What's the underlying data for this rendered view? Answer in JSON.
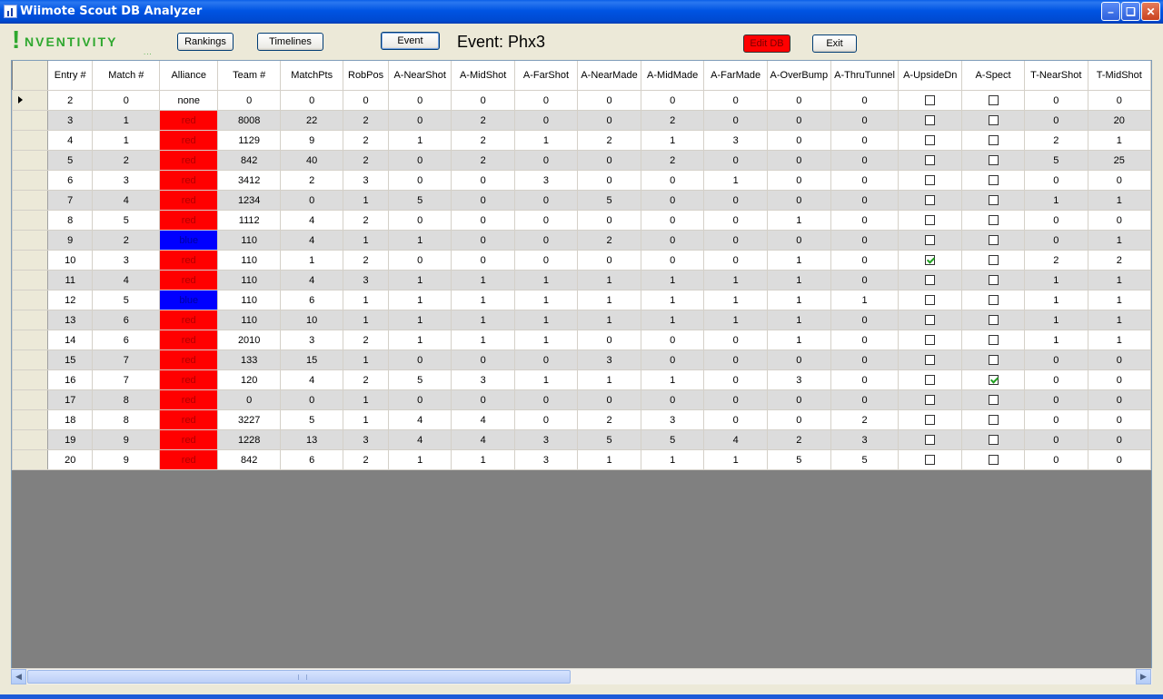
{
  "window": {
    "title": "Wiimote Scout DB Analyzer",
    "controls": [
      "minimize-icon",
      "restore-icon",
      "close-icon"
    ]
  },
  "logo": {
    "text": "NVENTIVITY",
    "bang": "!",
    "dots": "..."
  },
  "toolbar": {
    "rankings": "Rankings",
    "timelines": "Timelines",
    "event": "Event",
    "event_label": "Event:  Phx3",
    "edit_db": "Edit DB",
    "exit": "Exit"
  },
  "colors": {
    "red": "#ff0000",
    "blue": "#0000ff",
    "accent_green": "#2fa82f"
  },
  "grid": {
    "columns": [
      "Entry #",
      "Match #",
      "Alliance",
      "Team #",
      "MatchPts",
      "RobPos",
      "A-NearShot",
      "A-MidShot",
      "A-FarShot",
      "A-NearMade",
      "A-MidMade",
      "A-FarMade",
      "A-OverBump",
      "A-ThruTunnel",
      "A-UpsideDn",
      "A-Spect",
      "T-NearShot",
      "T-MidShot"
    ],
    "rows": [
      [
        "2",
        "0",
        "none",
        "0",
        "0",
        "0",
        "0",
        "0",
        "0",
        "0",
        "0",
        "0",
        "0",
        "0",
        false,
        false,
        "0",
        "0"
      ],
      [
        "3",
        "1",
        "red",
        "8008",
        "22",
        "2",
        "0",
        "2",
        "0",
        "0",
        "2",
        "0",
        "0",
        "0",
        false,
        false,
        "0",
        "20"
      ],
      [
        "4",
        "1",
        "red",
        "1129",
        "9",
        "2",
        "1",
        "2",
        "1",
        "2",
        "1",
        "3",
        "0",
        "0",
        false,
        false,
        "2",
        "1"
      ],
      [
        "5",
        "2",
        "red",
        "842",
        "40",
        "2",
        "0",
        "2",
        "0",
        "0",
        "2",
        "0",
        "0",
        "0",
        false,
        false,
        "5",
        "25"
      ],
      [
        "6",
        "3",
        "red",
        "3412",
        "2",
        "3",
        "0",
        "0",
        "3",
        "0",
        "0",
        "1",
        "0",
        "0",
        false,
        false,
        "0",
        "0"
      ],
      [
        "7",
        "4",
        "red",
        "1234",
        "0",
        "1",
        "5",
        "0",
        "0",
        "5",
        "0",
        "0",
        "0",
        "0",
        false,
        false,
        "1",
        "1"
      ],
      [
        "8",
        "5",
        "red",
        "1112",
        "4",
        "2",
        "0",
        "0",
        "0",
        "0",
        "0",
        "0",
        "1",
        "0",
        false,
        false,
        "0",
        "0"
      ],
      [
        "9",
        "2",
        "blue",
        "110",
        "4",
        "1",
        "1",
        "0",
        "0",
        "2",
        "0",
        "0",
        "0",
        "0",
        false,
        false,
        "0",
        "1"
      ],
      [
        "10",
        "3",
        "red",
        "110",
        "1",
        "2",
        "0",
        "0",
        "0",
        "0",
        "0",
        "0",
        "1",
        "0",
        true,
        false,
        "2",
        "2"
      ],
      [
        "11",
        "4",
        "red",
        "110",
        "4",
        "3",
        "1",
        "1",
        "1",
        "1",
        "1",
        "1",
        "1",
        "0",
        false,
        false,
        "1",
        "1"
      ],
      [
        "12",
        "5",
        "blue",
        "110",
        "6",
        "1",
        "1",
        "1",
        "1",
        "1",
        "1",
        "1",
        "1",
        "1",
        false,
        false,
        "1",
        "1"
      ],
      [
        "13",
        "6",
        "red",
        "110",
        "10",
        "1",
        "1",
        "1",
        "1",
        "1",
        "1",
        "1",
        "1",
        "0",
        false,
        false,
        "1",
        "1"
      ],
      [
        "14",
        "6",
        "red",
        "2010",
        "3",
        "2",
        "1",
        "1",
        "1",
        "0",
        "0",
        "0",
        "1",
        "0",
        false,
        false,
        "1",
        "1"
      ],
      [
        "15",
        "7",
        "red",
        "133",
        "15",
        "1",
        "0",
        "0",
        "0",
        "3",
        "0",
        "0",
        "0",
        "0",
        false,
        false,
        "0",
        "0"
      ],
      [
        "16",
        "7",
        "red",
        "120",
        "4",
        "2",
        "5",
        "3",
        "1",
        "1",
        "1",
        "0",
        "3",
        "0",
        false,
        true,
        "0",
        "0"
      ],
      [
        "17",
        "8",
        "red",
        "0",
        "0",
        "1",
        "0",
        "0",
        "0",
        "0",
        "0",
        "0",
        "0",
        "0",
        false,
        false,
        "0",
        "0"
      ],
      [
        "18",
        "8",
        "red",
        "3227",
        "5",
        "1",
        "4",
        "4",
        "0",
        "2",
        "3",
        "0",
        "0",
        "2",
        false,
        false,
        "0",
        "0"
      ],
      [
        "19",
        "9",
        "red",
        "1228",
        "13",
        "3",
        "4",
        "4",
        "3",
        "5",
        "5",
        "4",
        "2",
        "3",
        false,
        false,
        "0",
        "0"
      ],
      [
        "20",
        "9",
        "red",
        "842",
        "6",
        "2",
        "1",
        "1",
        "3",
        "1",
        "1",
        "1",
        "5",
        "5",
        false,
        false,
        "0",
        "0"
      ]
    ],
    "current_row": 0
  },
  "scrollbar": {
    "position_fraction": 0.0,
    "visible_fraction": 0.49
  }
}
